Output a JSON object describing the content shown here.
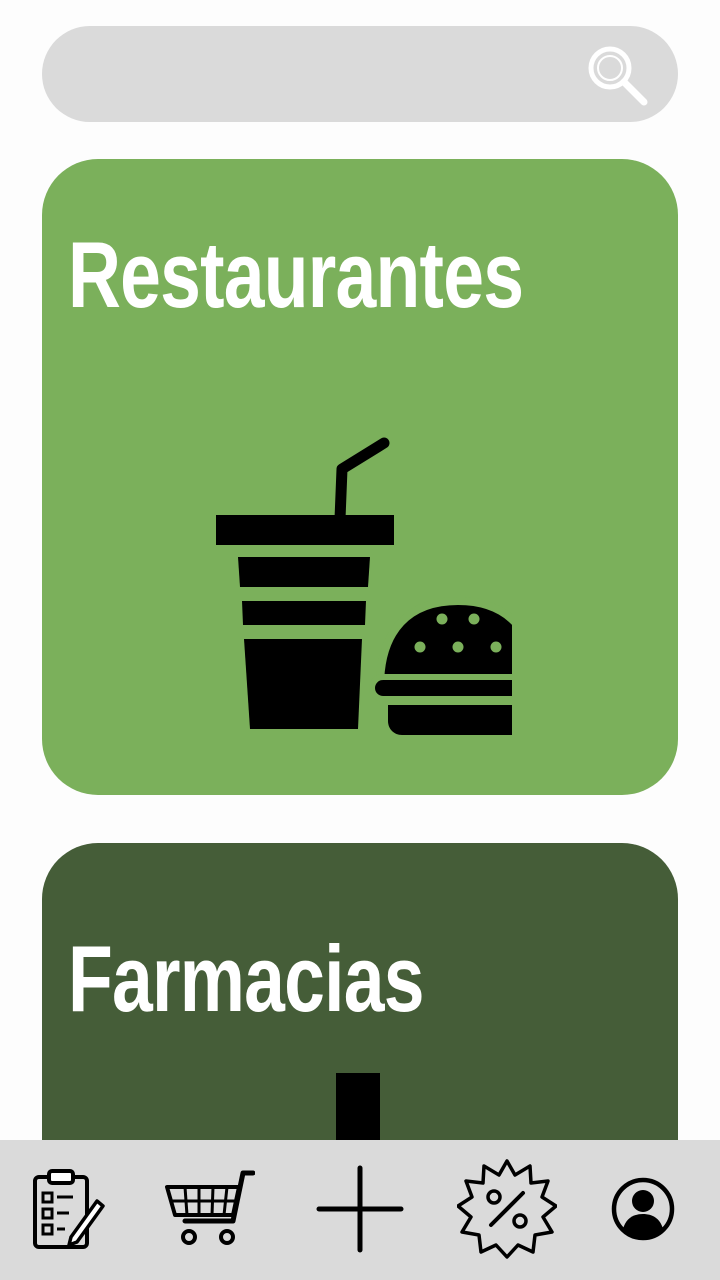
{
  "search": {
    "value": "",
    "placeholder": "",
    "icon": "search-icon"
  },
  "categories": [
    {
      "label": "Restaurantes",
      "color": "#7bb05b",
      "icon": "fastfood-icon"
    },
    {
      "label": "Farmacias",
      "color": "#455d38",
      "icon": "pharmacy-icon"
    }
  ],
  "bottom_nav": {
    "background": "#dadada",
    "items": [
      {
        "icon": "orders-clipboard-icon"
      },
      {
        "icon": "shopping-cart-icon"
      },
      {
        "icon": "add-icon"
      },
      {
        "icon": "discount-badge-icon"
      },
      {
        "icon": "profile-icon"
      }
    ]
  }
}
